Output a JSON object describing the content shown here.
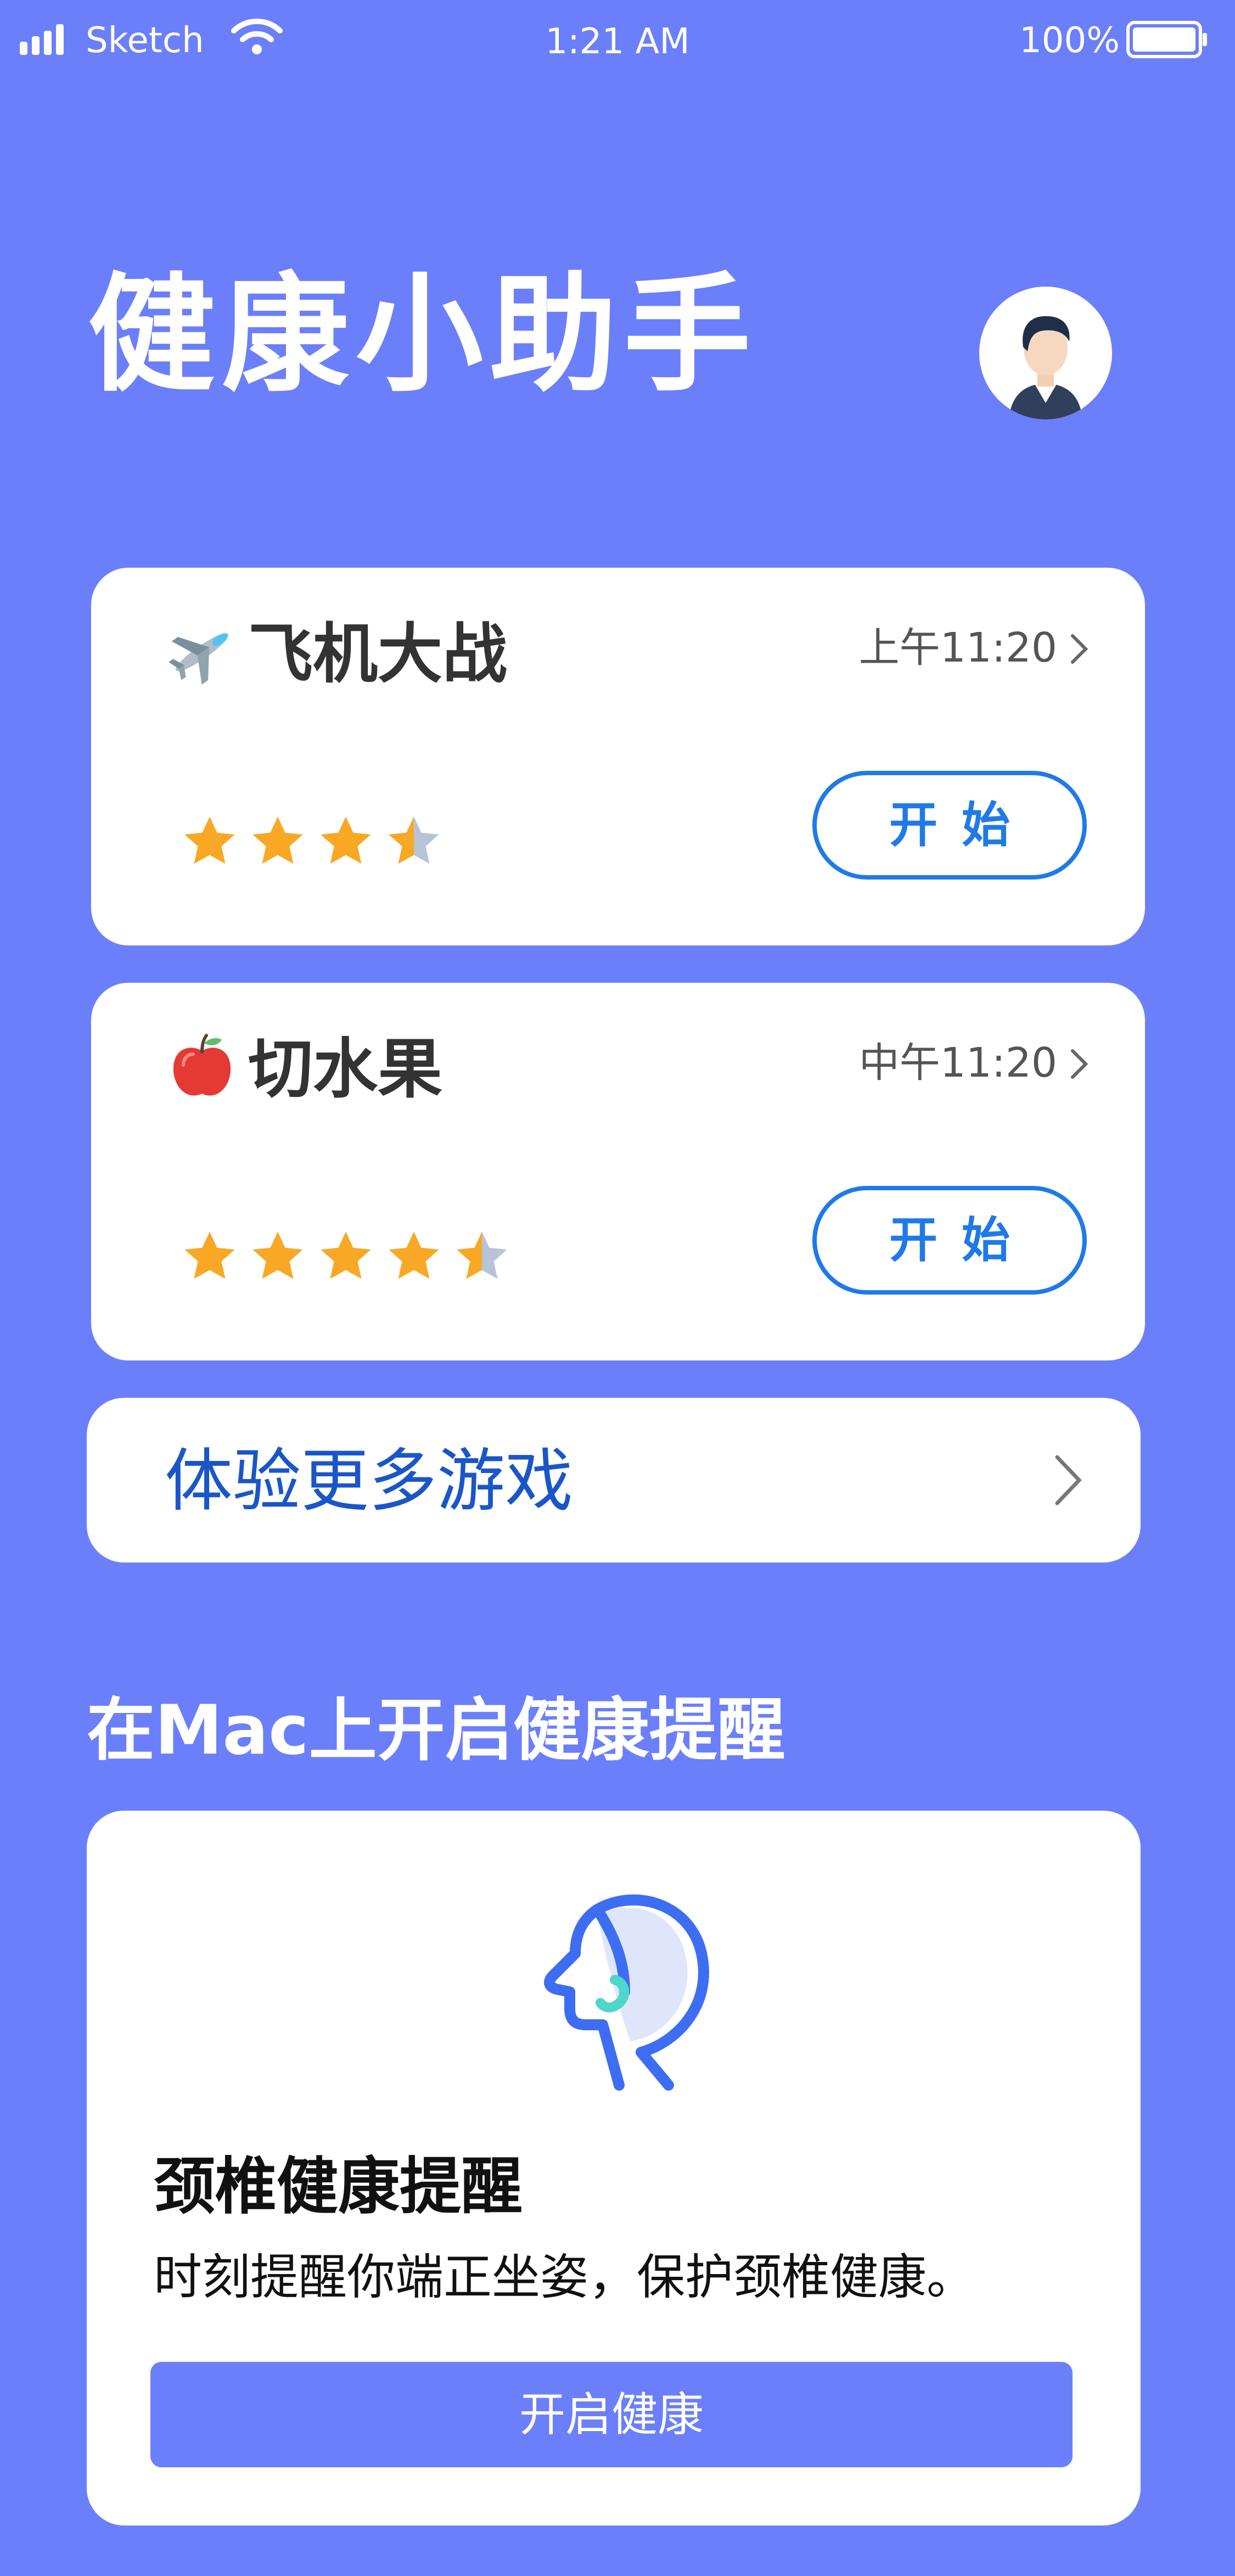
{
  "status_bar": {
    "carrier": "Sketch",
    "time": "1:21 AM",
    "battery": "100%"
  },
  "header": {
    "title": "健康小助手"
  },
  "games": [
    {
      "icon": "airplane-icon",
      "title": "飞机大战",
      "time": "上午11:20",
      "rating": 3.5,
      "button": "开始"
    },
    {
      "icon": "apple-icon",
      "title": "切水果",
      "time": "中午11:20",
      "rating": 4.5,
      "button": "开始"
    }
  ],
  "more_games": {
    "label": "体验更多游戏"
  },
  "section": {
    "title": "在Mac上开启健康提醒"
  },
  "health_card": {
    "title": "颈椎健康提醒",
    "description": "时刻提醒你端正坐姿，保护颈椎健康。",
    "button": "开启健康"
  },
  "colors": {
    "background": "#6b7ffb",
    "accent_blue": "#1f7ae8",
    "star": "#f9a825",
    "star_empty": "#b7c3d6"
  }
}
